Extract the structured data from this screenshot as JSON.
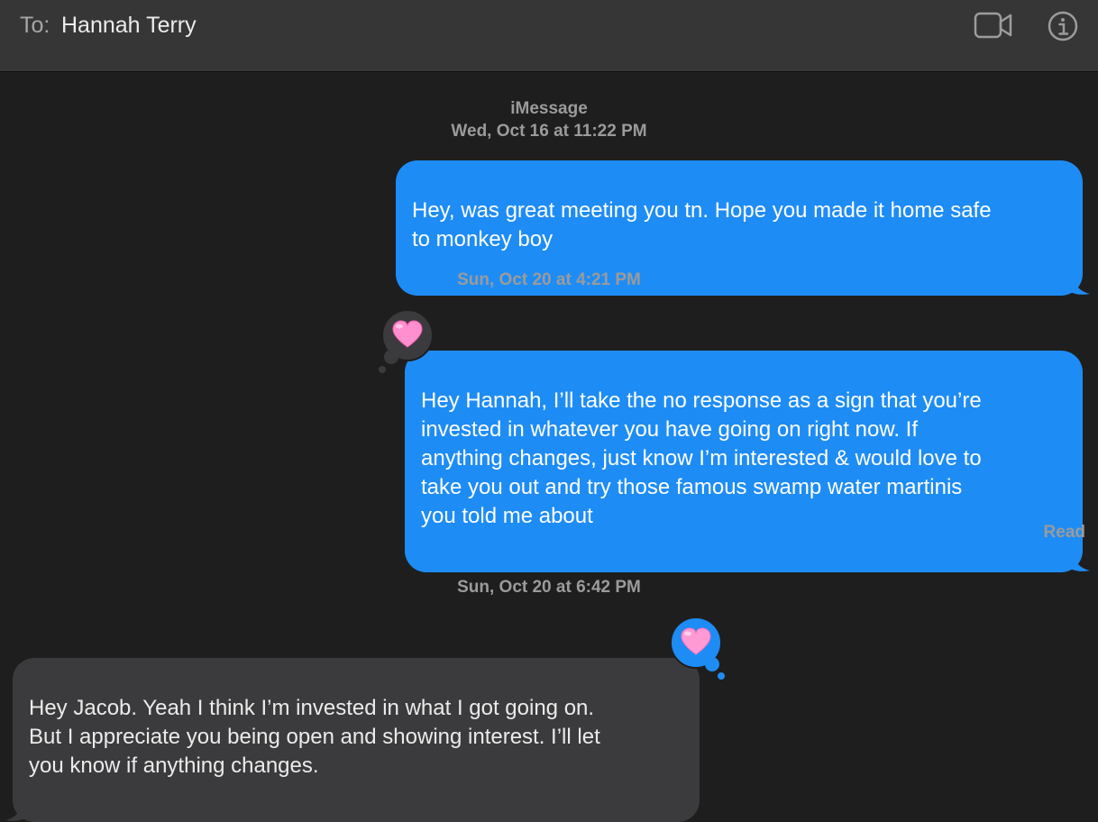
{
  "header": {
    "to_label": "To:",
    "recipient": "Hannah Terry",
    "video_icon": "video-camera-icon",
    "info_icon": "info-circle-icon"
  },
  "conversation": {
    "service": "iMessage",
    "timestamps": [
      "Wed, Oct 16 at 11:22 PM",
      "Sun, Oct 20 at 4:21 PM",
      "Sun, Oct 20 at 6:42 PM"
    ],
    "messages": [
      {
        "direction": "sent",
        "text": "Hey, was great meeting you tn. Hope you made it home safe\nto monkey boy"
      },
      {
        "direction": "sent",
        "text": "Hey Hannah, I’ll take the no response as a sign that you’re\ninvested in whatever you have going on right now. If\nanything changes, just know I’m interested & would love to\ntake you out and try those famous swamp water martinis\nyou told me about",
        "tapback": "heart"
      },
      {
        "direction": "received",
        "text": "Hey Jacob. Yeah I think I’m invested in what I got going on.\nBut I appreciate you being open and showing interest. I’ll let\nyou know if anything changes.",
        "tapback": "heart"
      }
    ],
    "read_status": "Read"
  },
  "colors": {
    "sent_bubble": "#1e8cf5",
    "received_bubble": "#3b3b3d",
    "background": "#1e1e1e",
    "header": "#363636"
  }
}
